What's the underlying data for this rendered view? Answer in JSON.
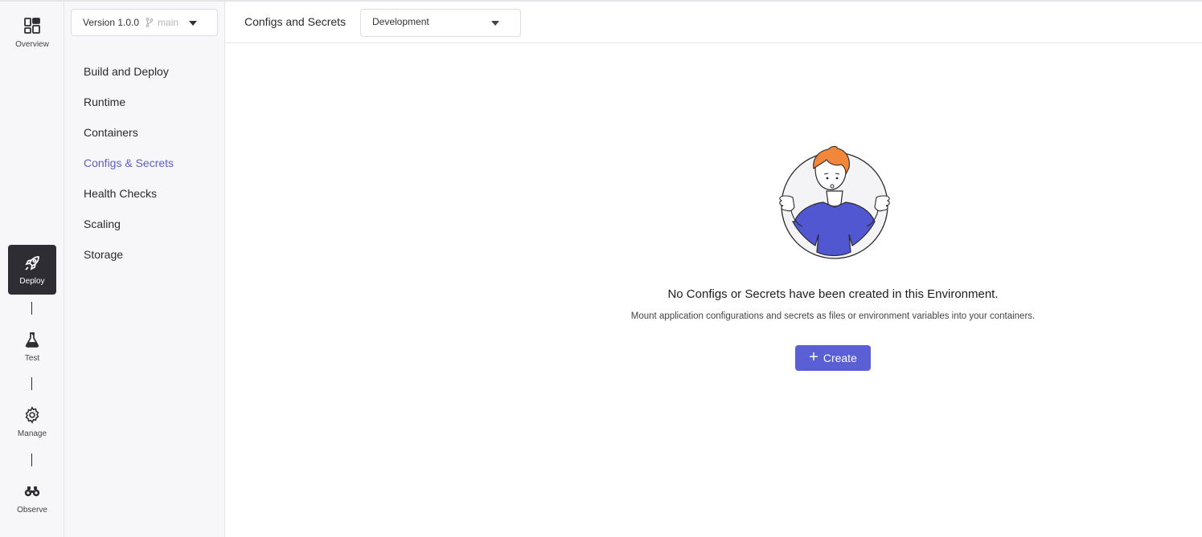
{
  "rail": {
    "overview": "Overview",
    "deploy": "Deploy",
    "test": "Test",
    "manage": "Manage",
    "observe": "Observe"
  },
  "sidebar": {
    "version": "Version 1.0.0",
    "branch": "main",
    "items": [
      {
        "label": "Build and Deploy"
      },
      {
        "label": "Runtime"
      },
      {
        "label": "Containers"
      },
      {
        "label": "Configs & Secrets"
      },
      {
        "label": "Health Checks"
      },
      {
        "label": "Scaling"
      },
      {
        "label": "Storage"
      }
    ]
  },
  "header": {
    "title": "Configs and Secrets",
    "environment": "Development"
  },
  "empty_state": {
    "title": "No Configs or Secrets have been created in this Environment.",
    "description": "Mount application configurations and secrets as files or environment variables into your containers.",
    "create_label": "Create"
  },
  "colors": {
    "accent": "#5b5fd6",
    "active_rail": "#2d2d33"
  }
}
